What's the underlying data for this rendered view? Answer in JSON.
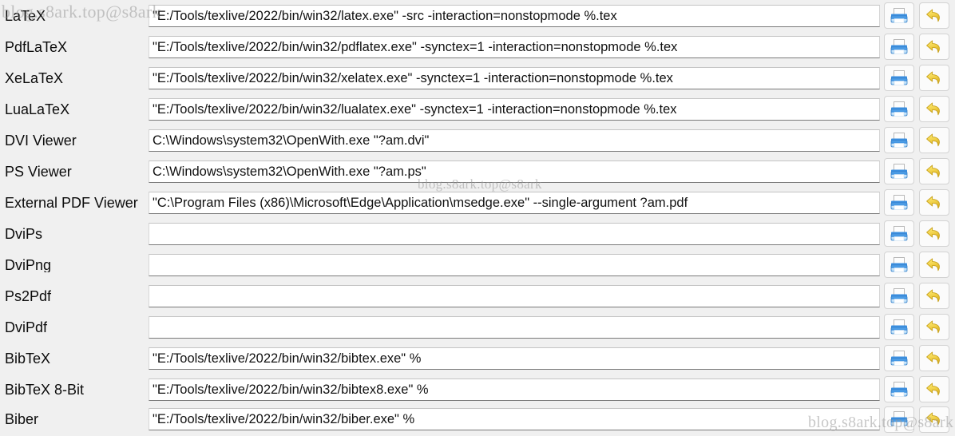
{
  "watermark": {
    "text": "blog.s8ark.top@s8ark"
  },
  "colors": {
    "background": "#f0f0f0",
    "field_background": "#ffffff",
    "field_border": "#cfcfcf",
    "text": "#0c0c0c",
    "printer_icon_blue": "#3b8fe0",
    "undo_icon_yellow": "#f2d24b",
    "button_face": "#fbfbfb"
  },
  "buttons": {
    "browse_label": "browse-button",
    "reset_label": "reset-button",
    "browse_icon": "printer-icon",
    "reset_icon": "undo-arrow-icon"
  },
  "rows": [
    {
      "label": "LaTeX",
      "value": "\"E:/Tools/texlive/2022/bin/win32/latex.exe\" -src -interaction=nonstopmode %.tex"
    },
    {
      "label": "PdfLaTeX",
      "value": "\"E:/Tools/texlive/2022/bin/win32/pdflatex.exe\" -synctex=1 -interaction=nonstopmode %.tex"
    },
    {
      "label": "XeLaTeX",
      "value": "\"E:/Tools/texlive/2022/bin/win32/xelatex.exe\" -synctex=1 -interaction=nonstopmode %.tex"
    },
    {
      "label": "LuaLaTeX",
      "value": "\"E:/Tools/texlive/2022/bin/win32/lualatex.exe\" -synctex=1 -interaction=nonstopmode %.tex"
    },
    {
      "label": "DVI Viewer",
      "value": "C:\\Windows\\system32\\OpenWith.exe \"?am.dvi\""
    },
    {
      "label": "PS Viewer",
      "value": "C:\\Windows\\system32\\OpenWith.exe \"?am.ps\""
    },
    {
      "label": "External PDF Viewer",
      "value": "\"C:\\Program Files (x86)\\Microsoft\\Edge\\Application\\msedge.exe\" --single-argument ?am.pdf"
    },
    {
      "label": "DviPs",
      "value": ""
    },
    {
      "label": "DviPng",
      "value": ""
    },
    {
      "label": "Ps2Pdf",
      "value": ""
    },
    {
      "label": "DviPdf",
      "value": ""
    },
    {
      "label": "BibTeX",
      "value": "\"E:/Tools/texlive/2022/bin/win32/bibtex.exe\" %"
    },
    {
      "label": "BibTeX 8-Bit",
      "value": "\"E:/Tools/texlive/2022/bin/win32/bibtex8.exe\" %"
    },
    {
      "label": "Biber",
      "value": "\"E:/Tools/texlive/2022/bin/win32/biber.exe\" %"
    }
  ]
}
